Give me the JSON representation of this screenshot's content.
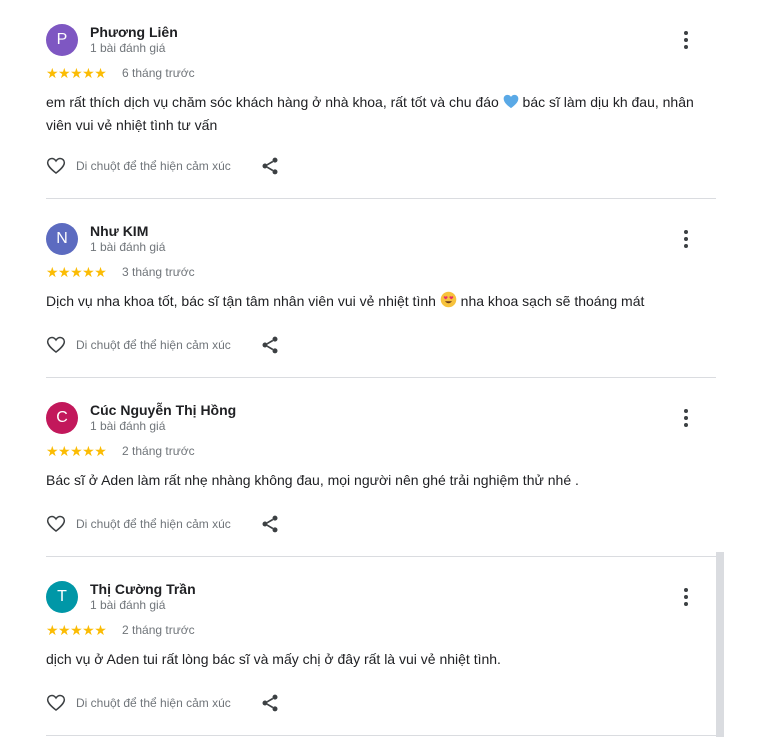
{
  "reviews": [
    {
      "initial": "P",
      "avatar_color": "#7e57c2",
      "name": "Phương Liên",
      "review_count": "1 bài đánh giá",
      "stars": "★★★★★",
      "time": "6 tháng trước",
      "text_before": "em rất thích dịch vụ chăm sóc khách hàng ở nhà khoa, rất tốt và chu đáo ",
      "emoji": "blue-heart-emoji",
      "text_after": " bác sĩ làm dịu kh đau, nhân viên vui vẻ nhiệt tình tư vấn",
      "react_label": "Di chuột để thể hiện cảm xúc"
    },
    {
      "initial": "N",
      "avatar_color": "#5c6bc0",
      "name": "Như KIM",
      "review_count": "1 bài đánh giá",
      "stars": "★★★★★",
      "time": "3 tháng trước",
      "text_before": "Dịch vụ nha khoa tốt, bác sĩ tận tâm nhân viên vui vẻ nhiệt tình ",
      "emoji": "heart-eyes-emoji",
      "text_after": " nha khoa sạch sẽ thoáng mát",
      "react_label": "Di chuột để thể hiện cảm xúc"
    },
    {
      "initial": "C",
      "avatar_color": "#c2185b",
      "name": "Cúc Nguyễn Thị Hồng",
      "review_count": "1 bài đánh giá",
      "stars": "★★★★★",
      "time": "2 tháng trước",
      "text_before": "Bác sĩ ở Aden làm rất nhẹ nhàng không đau, mọi người nên ghé trải nghiệm thử nhé .",
      "emoji": "",
      "text_after": "",
      "react_label": "Di chuột để thể hiện cảm xúc"
    },
    {
      "initial": "T",
      "avatar_color": "#0097a7",
      "name": "Thị Cường Trần",
      "review_count": "1 bài đánh giá",
      "stars": "★★★★★",
      "time": "2 tháng trước",
      "text_before": "dịch vụ ở Aden tui rất lòng bác sĩ và mấy chị ở đây rất là vui vẻ nhiệt tình.",
      "emoji": "",
      "text_after": "",
      "react_label": "Di chuột để thể hiện cảm xúc"
    }
  ],
  "ratings": {
    "stars_out_of_5": [
      5,
      5,
      5,
      5
    ]
  }
}
